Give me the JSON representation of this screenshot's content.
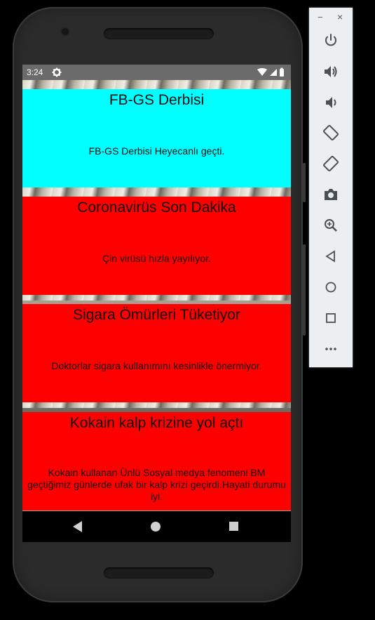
{
  "status_bar": {
    "time": "3:24"
  },
  "cards": [
    {
      "title": "FB-GS Derbisi",
      "body": "FB-GS Derbisi Heyecanlı geçti.",
      "color": "#00FFFF"
    },
    {
      "title": "Coronavirüs Son Dakika",
      "body": "Çin virüsü hızla yayılıyor.",
      "color": "#FF0000"
    },
    {
      "title": "Sigara Ömürleri Tüketiyor",
      "body": "Doktorlar sigara kullanımını kesinlikle önermiyor.",
      "color": "#FF0000"
    },
    {
      "title": "Kokain kalp krizine yol açtı",
      "body": "Kokain kullanan Ünlü Sosyal medya fenomeni BM geçtiğimiz günlerde ufak bir kalp krizi geçirdi.Hayati durumu iyi.",
      "color": "#FF0000"
    }
  ],
  "emulator_toolbar": {
    "minimize": "−",
    "close": "×",
    "buttons": [
      "power-icon",
      "volume-up-icon",
      "volume-down-icon",
      "rotate-left-icon",
      "rotate-right-icon",
      "screenshot-icon",
      "zoom-icon",
      "back-icon",
      "home-icon",
      "overview-icon",
      "more-icon"
    ]
  }
}
